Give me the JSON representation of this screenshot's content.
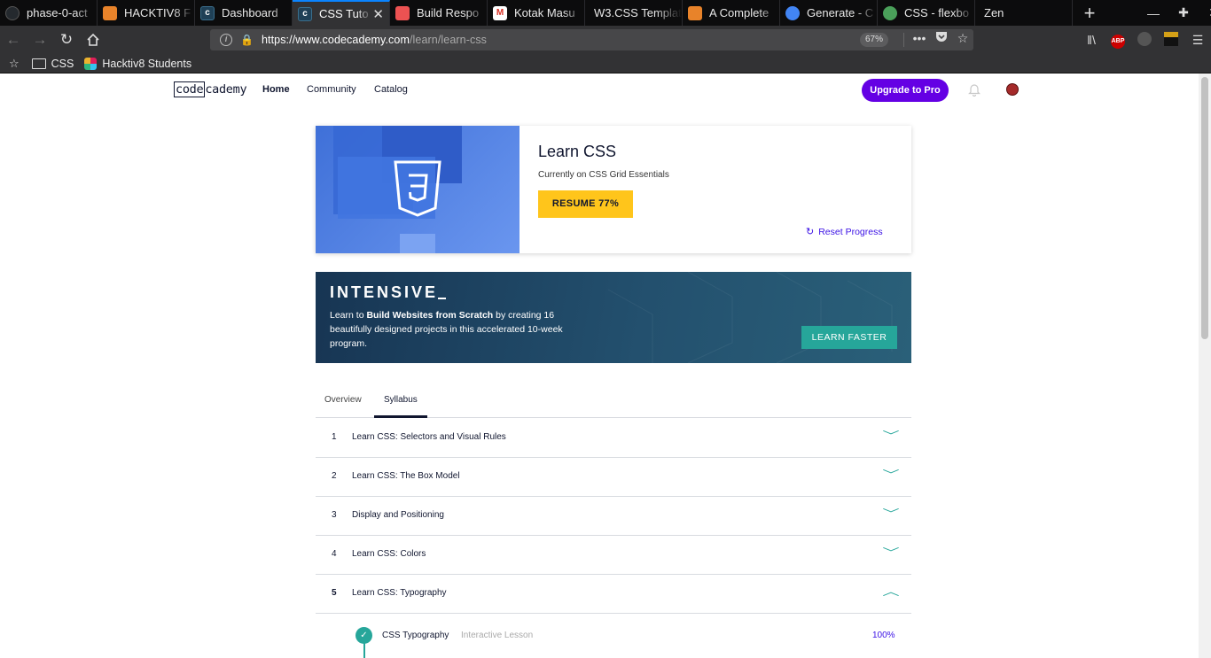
{
  "browser": {
    "tabs": [
      {
        "label": "phase-0-act",
        "icon": "github-icon",
        "color": "#24292e"
      },
      {
        "label": "HACKTIV8 F",
        "icon": "hacktiv8-icon",
        "color": "#e8832a"
      },
      {
        "label": "Dashboard",
        "icon": "codecademy-icon",
        "color": "#1f4056"
      },
      {
        "label": "CSS Tuto",
        "icon": "codecademy-icon",
        "color": "#1f4056",
        "active": true
      },
      {
        "label": "Build Respo",
        "icon": "udemy-icon",
        "color": "#ec5252"
      },
      {
        "label": "Kotak Masu",
        "icon": "gmail-icon",
        "color": "#d93025"
      },
      {
        "label": "W3.CSS Templat",
        "icon": "none",
        "color": "#0c0c0d"
      },
      {
        "label": "A Complete",
        "icon": "csstricks-icon",
        "color": "#e8832a"
      },
      {
        "label": "Generate - C",
        "icon": "chrome-icon",
        "color": "#4285f4"
      },
      {
        "label": "CSS - flexbo",
        "icon": "globe-icon",
        "color": "#4aa05a"
      },
      {
        "label": "Zen",
        "icon": "none",
        "color": "#0c0c0d"
      }
    ],
    "url_host": "https://www.codecademy.com",
    "url_path": "/learn/learn-css",
    "zoom": "67%",
    "bookmarks": [
      {
        "label": "CSS",
        "icon": "folder-icon"
      },
      {
        "label": "Hacktiv8 Students",
        "icon": "slack-icon"
      }
    ],
    "abp_label": "ABP"
  },
  "header": {
    "logo_code": "code",
    "logo_rest": "cademy",
    "nav": [
      "Home",
      "Community",
      "Catalog"
    ],
    "upgrade_label": "Upgrade to Pro"
  },
  "course": {
    "title": "Learn CSS",
    "subtitle": "Currently on CSS Grid Essentials",
    "resume_label": "RESUME 77%",
    "progress": 0.77,
    "reset_label": "Reset Progress"
  },
  "intensive": {
    "title": "INTENSIVE",
    "desc_pre": "Learn to ",
    "desc_bold": "Build Websites from Scratch",
    "desc_post": " by creating 16 beautifully designed projects in this accelerated 10-week program.",
    "cta_label": "LEARN FASTER"
  },
  "tabs": {
    "overview": "Overview",
    "syllabus": "Syllabus"
  },
  "syllabus": [
    {
      "num": "1",
      "title": "Learn CSS: Selectors and Visual Rules",
      "open": false
    },
    {
      "num": "2",
      "title": "Learn CSS: The Box Model",
      "open": false
    },
    {
      "num": "3",
      "title": "Display and Positioning",
      "open": false
    },
    {
      "num": "4",
      "title": "Learn CSS: Colors",
      "open": false
    },
    {
      "num": "5",
      "title": "Learn CSS: Typography",
      "open": true
    }
  ],
  "lesson": {
    "title": "CSS Typography",
    "kind": "Interactive Lesson",
    "progress": "100%"
  },
  "colors": {
    "brand_purple": "#6400e4",
    "resume_yellow": "#ffc51b",
    "teal": "#26a69a"
  }
}
